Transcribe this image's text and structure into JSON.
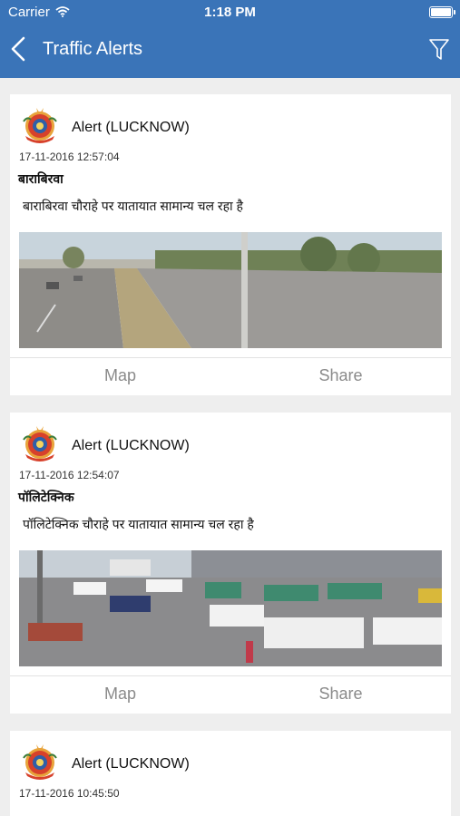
{
  "status_bar": {
    "carrier": "Carrier",
    "time": "1:18 PM"
  },
  "header": {
    "title": "Traffic Alerts"
  },
  "icons": {
    "back": "chevron-left-icon",
    "filter": "filter-funnel-icon",
    "emblem": "up-police-emblem-icon"
  },
  "colors": {
    "header": "#3a74b8",
    "background": "#eeeeee",
    "action_text": "#8a8a8a"
  },
  "alerts": [
    {
      "title": "Alert (LUCKNOW)",
      "timestamp": "17-11-2016 12:57:04",
      "location": "बाराबिरवा",
      "description": "बाराबिरवा चौराहे पर यातायात सामान्य चल रहा है",
      "map_label": "Map",
      "share_label": "Share"
    },
    {
      "title": "Alert (LUCKNOW)",
      "timestamp": "17-11-2016 12:54:07",
      "location": "पॉलिटेक्निक",
      "description": "पॉलिटेक्निक चौराहे पर यातायात सामान्य चल रहा है",
      "map_label": "Map",
      "share_label": "Share"
    },
    {
      "title": "Alert (LUCKNOW)",
      "timestamp": "17-11-2016 10:45:50",
      "location": "",
      "description": "",
      "map_label": "",
      "share_label": ""
    }
  ]
}
